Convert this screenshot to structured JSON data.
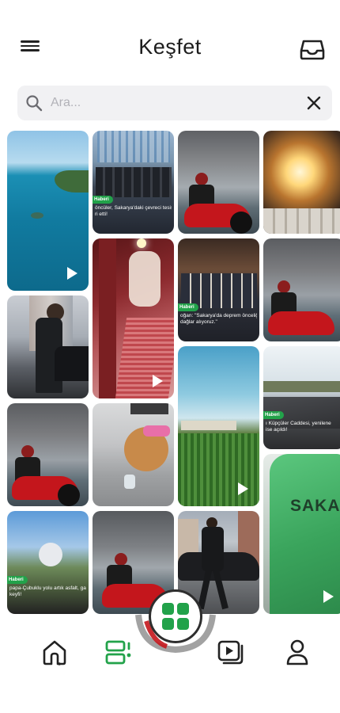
{
  "header": {
    "title": "Keşfet",
    "menu_icon": "hamburger-menu-icon",
    "inbox_icon": "inbox-tray-icon"
  },
  "search": {
    "placeholder": "Ara...",
    "value": "",
    "search_icon": "magnifier-icon",
    "clear_icon": "close-icon"
  },
  "grid": {
    "items": [
      {
        "kind": "video",
        "subject": "aerial lake"
      },
      {
        "kind": "news",
        "badge": "Haberi",
        "caption_l1": "öncüler, Sakarya'daki çevreci tesisler",
        "caption_l2": "ri etti!"
      },
      {
        "kind": "image",
        "subject": "rider on red motorcycle"
      },
      {
        "kind": "image",
        "subject": "fireplace"
      },
      {
        "kind": "video",
        "subject": "red train interior"
      },
      {
        "kind": "news",
        "badge": "Haberi",
        "caption_l1": "oğan: \"Sakarya'da deprem önceliğ",
        "caption_l2": "dağlar alıyoruz.\""
      },
      {
        "kind": "video",
        "subject": "man by car"
      },
      {
        "kind": "image",
        "subject": "rider on red motorcycle"
      },
      {
        "kind": "video",
        "subject": "corn field"
      },
      {
        "kind": "news",
        "badge": "Haberi",
        "caption_l1": "ı Küpçüler Caddesi, yenilene",
        "caption_l2": "ise açıldı!"
      },
      {
        "kind": "image",
        "subject": "rider on red motorcycle"
      },
      {
        "kind": "image",
        "subject": "dog"
      },
      {
        "kind": "video",
        "subject": "green jacket"
      },
      {
        "kind": "news",
        "badge": "Haberi",
        "caption_l1": "papa-Çubuklu yolu artık asfalt, ga",
        "caption_l2": "keyfi!"
      },
      {
        "kind": "image",
        "subject": "rider on red motorcycle"
      },
      {
        "kind": "image",
        "subject": "man walking"
      }
    ],
    "jacket_text": "SAKAR"
  },
  "bottom_nav": {
    "items": [
      {
        "icon": "home-icon"
      },
      {
        "icon": "feed-list-icon",
        "active": true
      },
      {
        "icon": "video-stack-icon"
      },
      {
        "icon": "profile-icon"
      }
    ],
    "fab_icon": "grid-squares-icon",
    "accent": "#22a24a"
  },
  "colors": {
    "accent": "#22a24a",
    "search_bg": "#f1f1f3",
    "text": "#1b1b1b"
  }
}
